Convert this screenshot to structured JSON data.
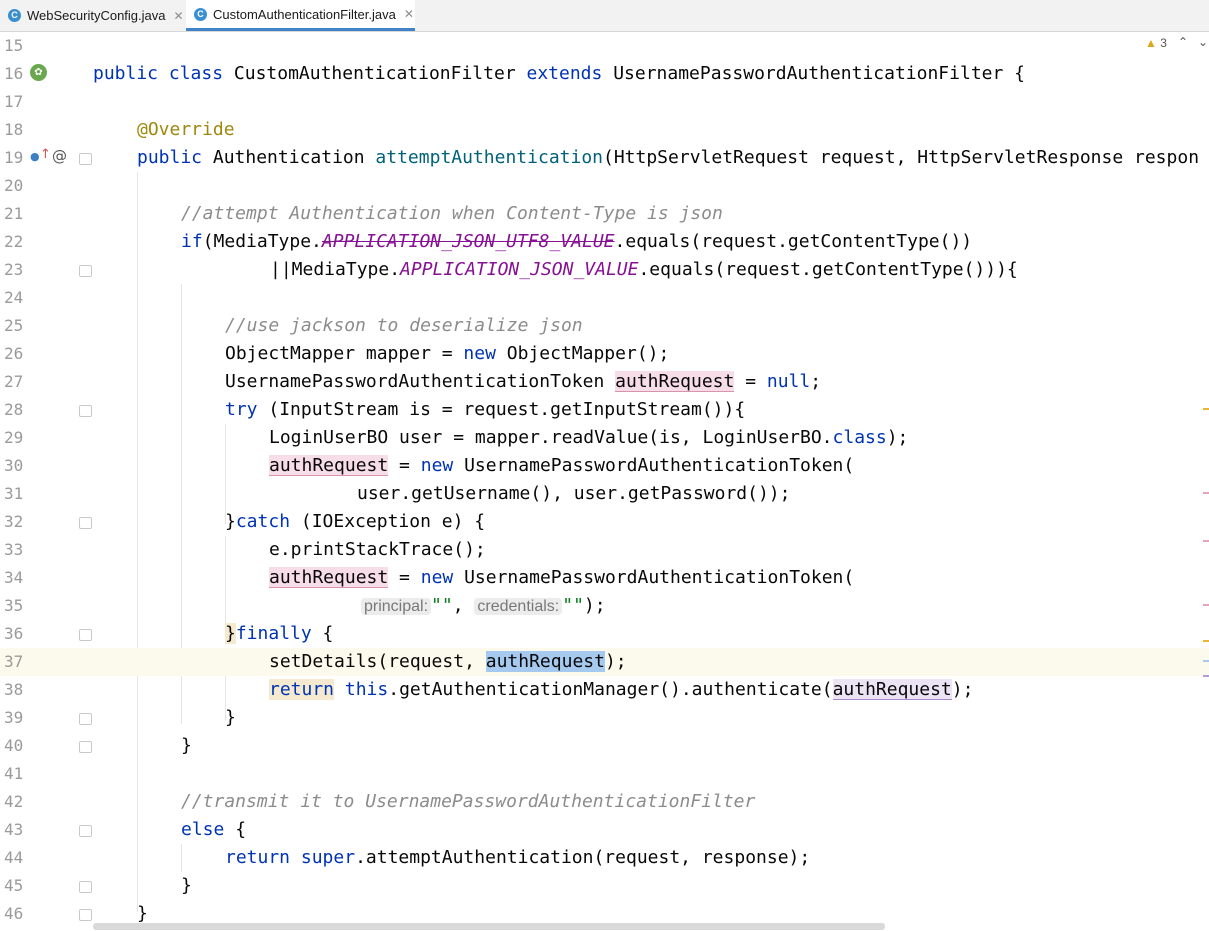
{
  "tabs": [
    {
      "label": "WebSecurityConfig.java",
      "icon": "class-file-icon",
      "active": false
    },
    {
      "label": "CustomAuthenticationFilter.java",
      "icon": "class-file-icon",
      "active": true
    }
  ],
  "tab_icon_letter": "C",
  "tab_close_glyph": "✕",
  "inspections": {
    "warning_count": "3"
  },
  "lines": [
    {
      "num": "15"
    },
    {
      "num": "16"
    },
    {
      "num": "17"
    },
    {
      "num": "18"
    },
    {
      "num": "19"
    },
    {
      "num": "20"
    },
    {
      "num": "21"
    },
    {
      "num": "22"
    },
    {
      "num": "23"
    },
    {
      "num": "24"
    },
    {
      "num": "25"
    },
    {
      "num": "26"
    },
    {
      "num": "27"
    },
    {
      "num": "28"
    },
    {
      "num": "29"
    },
    {
      "num": "30"
    },
    {
      "num": "31"
    },
    {
      "num": "32"
    },
    {
      "num": "33"
    },
    {
      "num": "34"
    },
    {
      "num": "35"
    },
    {
      "num": "36"
    },
    {
      "num": "37"
    },
    {
      "num": "38"
    },
    {
      "num": "39"
    },
    {
      "num": "40"
    },
    {
      "num": "41"
    },
    {
      "num": "42"
    },
    {
      "num": "43"
    },
    {
      "num": "44"
    },
    {
      "num": "45"
    },
    {
      "num": "46"
    }
  ],
  "code": {
    "l16": {
      "kw1": "public",
      "kw2": "class",
      "name": " CustomAuthenticationFilter ",
      "kw3": "extends",
      "rest": " UsernamePasswordAuthenticationFilter {"
    },
    "l18": {
      "ann": "@Override"
    },
    "l19": {
      "kw1": "public",
      "t1": " Authentication ",
      "fn": "attemptAuthentication",
      "rest": "(HttpServletRequest request, HttpServletResponse respon"
    },
    "l21": {
      "cmt": "//attempt Authentication when Content-Type is json"
    },
    "l22": {
      "kw": "if",
      "t1": "(MediaType.",
      "stc": "APPLICATION_JSON_UTF8_VALUE",
      "rest": ".equals(request.getContentType())"
    },
    "l23": {
      "t1": "||MediaType.",
      "stc": "APPLICATION_JSON_VALUE",
      "rest": ".equals(request.getContentType())){"
    },
    "l25": {
      "cmt": "//use jackson to deserialize json"
    },
    "l26": {
      "t1": "ObjectMapper mapper = ",
      "kw": "new",
      "rest": " ObjectMapper();"
    },
    "l27": {
      "t1": "UsernamePasswordAuthenticationToken ",
      "var": "authRequest",
      "t2": " = ",
      "kw": "null",
      "rest": ";"
    },
    "l28": {
      "kw": "try",
      "rest": " (InputStream is = request.getInputStream()){"
    },
    "l29": {
      "t1": "LoginUserBO user = mapper.readValue(is, LoginUserBO.",
      "kw": "class",
      "rest": ");"
    },
    "l30": {
      "var": "authRequest",
      "t1": " = ",
      "kw": "new",
      "rest": " UsernamePasswordAuthenticationToken("
    },
    "l31": {
      "t1": "user.getUsername(), user.getPassword());"
    },
    "l32": {
      "t1": "}",
      "kw": "catch",
      "rest": " (IOException e) {"
    },
    "l33": {
      "t1": "e.printStackTrace();"
    },
    "l34": {
      "var": "authRequest",
      "t1": " = ",
      "kw": "new",
      "rest": " UsernamePasswordAuthenticationToken("
    },
    "l35": {
      "hint1": "principal:",
      "str1": "\"\"",
      "t1": ", ",
      "hint2": "credentials:",
      "str2": "\"\"",
      "rest": ");"
    },
    "l36": {
      "t1": "}",
      "kw": "finally",
      "rest": " {"
    },
    "l37": {
      "t1": "setDetails(request, ",
      "var": "authRequest",
      "rest": ");"
    },
    "l38": {
      "kw1": "return",
      "t1": " ",
      "kw2": "this",
      "t2": ".getAuthenticationManager().authenticate(",
      "var": "authRequest",
      "rest": ");"
    },
    "l39": {
      "t1": "}"
    },
    "l40": {
      "t1": "}"
    },
    "l42": {
      "cmt": "//transmit it to UsernamePasswordAuthenticationFilter"
    },
    "l43": {
      "kw": "else",
      "rest": " {"
    },
    "l44": {
      "kw1": "return",
      "t1": " ",
      "kw2": "super",
      "rest": ".attemptAuthentication(request, response);"
    },
    "l45": {
      "t1": "}"
    },
    "l46": {
      "t1": "}"
    }
  },
  "colors": {
    "keyword": "#0033b3",
    "annotation": "#9e880d",
    "comment": "#8c8c8c",
    "method": "#00627a",
    "static_field": "#871094",
    "string": "#067d17"
  }
}
